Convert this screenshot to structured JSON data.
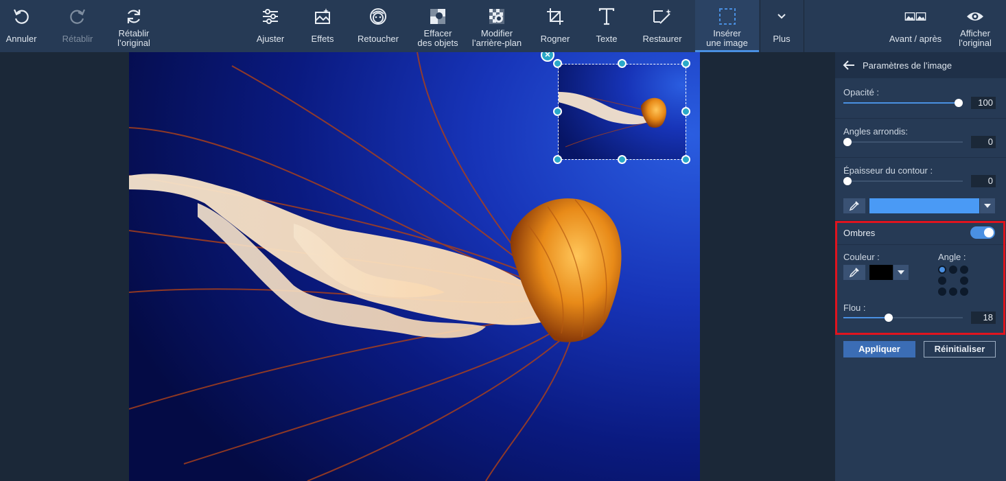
{
  "toolbar": {
    "undo": "Annuler",
    "redo": "Rétablir",
    "restore_original": "Rétablir\nl’original",
    "adjust": "Ajuster",
    "effects": "Effets",
    "retouch": "Retoucher",
    "erase_objects": "Effacer\ndes objets",
    "change_background": "Modifier\nl’arrière-plan",
    "crop": "Rogner",
    "text": "Texte",
    "restore": "Restaurer",
    "insert_image": "Insérer\nune image",
    "more": "Plus",
    "before_after": "Avant / après",
    "show_original": "Afficher\nl’original"
  },
  "panel": {
    "title": "Paramètres de l’image",
    "opacity": {
      "label": "Opacité :",
      "value": "100",
      "fraction": 1.0
    },
    "rounded_corners": {
      "label": "Angles arrondis:",
      "value": "0",
      "fraction": 0
    },
    "outline_thickness": {
      "label": "Épaisseur du contour :",
      "value": "0",
      "fraction": 0
    },
    "outline_color": "#4a9af5",
    "shadows": {
      "label": "Ombres",
      "enabled": true,
      "color_label": "Couleur :",
      "color": "#000000",
      "angle_label": "Angle :",
      "blur": {
        "label": "Flou :",
        "value": "18",
        "fraction": 0.37
      }
    },
    "apply": "Appliquer",
    "reset": "Réinitialiser"
  },
  "colors": {
    "toolbar_bg": "#263a55",
    "accent": "#4a90e2",
    "highlight": "#e0141e"
  }
}
